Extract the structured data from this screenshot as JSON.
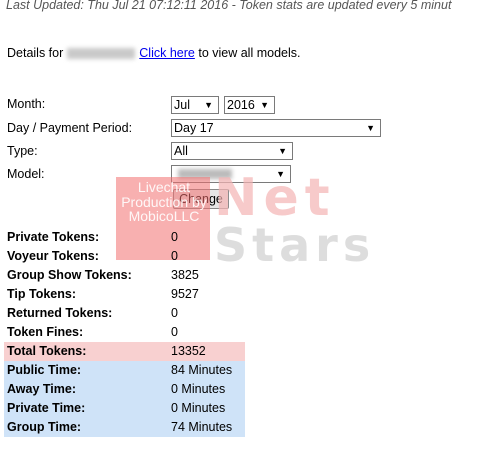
{
  "header": {
    "last_updated": "Last Updated: Thu Jul 21 07:12:11 2016 - Token stats are updated every 5 minut"
  },
  "details": {
    "prefix": "Details for",
    "link_text": "Click here",
    "suffix": "to view all models."
  },
  "form": {
    "month_label": "Month:",
    "month_value": "Jul",
    "year_value": "2016",
    "period_label": "Day / Payment Period:",
    "period_value": "Day 17",
    "type_label": "Type:",
    "type_value": "All",
    "model_label": "Model:",
    "change_button": "Change"
  },
  "watermark": {
    "text": "Livechat Production by MobicoLLC",
    "net": "Net",
    "stars": "Stars",
    "color": "#f27070"
  },
  "stats": [
    {
      "label": "Private Tokens:",
      "value": "0"
    },
    {
      "label": "Voyeur Tokens:",
      "value": "0"
    },
    {
      "label": "Group Show Tokens:",
      "value": "3825"
    },
    {
      "label": "Tip Tokens:",
      "value": "9527"
    },
    {
      "label": "Returned Tokens:",
      "value": "0"
    },
    {
      "label": "Token Fines:",
      "value": "0"
    },
    {
      "label": "Total Tokens:",
      "value": "13352"
    },
    {
      "label": "Public Time:",
      "value": "84 Minutes"
    },
    {
      "label": "Away Time:",
      "value": "0 Minutes"
    },
    {
      "label": "Private Time:",
      "value": "0 Minutes"
    },
    {
      "label": "Group Time:",
      "value": "74 Minutes"
    }
  ],
  "colors": {
    "total_highlight": "#f8d0d0",
    "time_highlight": "#cfe3f8",
    "link": "#0000ee"
  }
}
